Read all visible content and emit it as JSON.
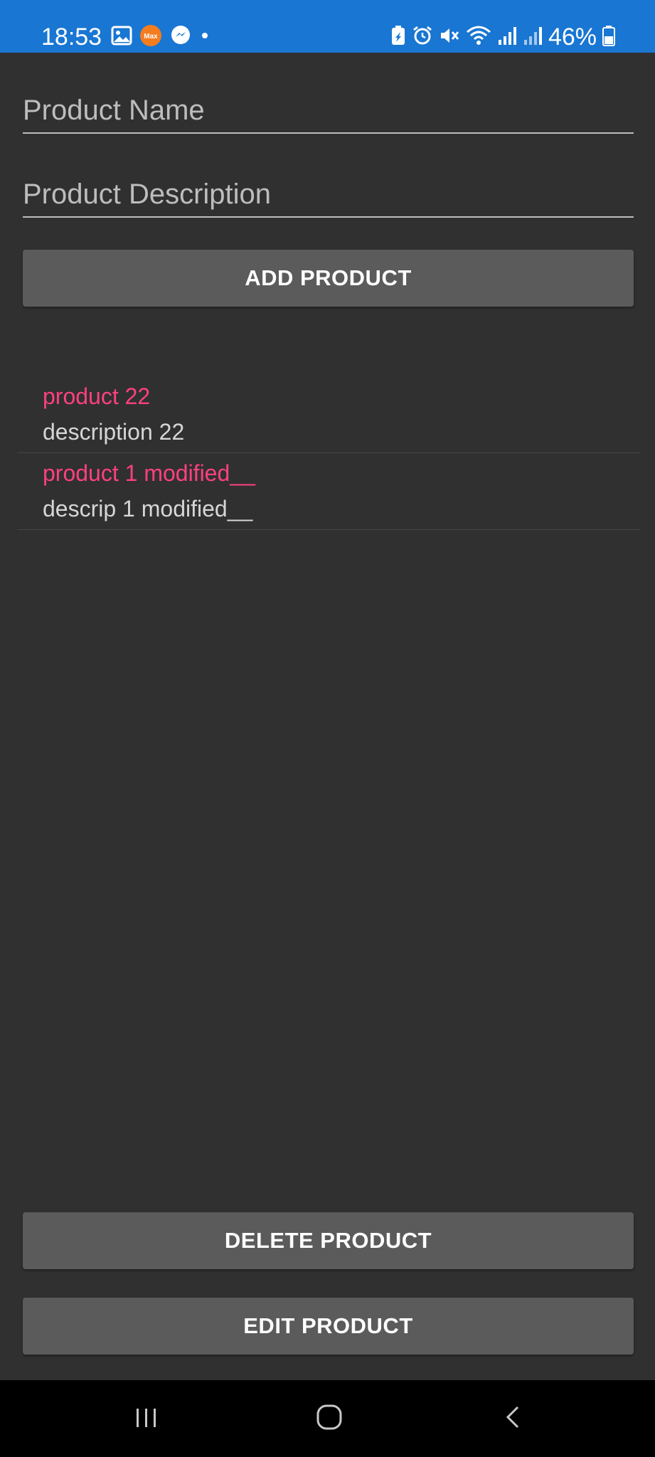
{
  "status_bar": {
    "time": "18:53",
    "battery": "46%",
    "left_icons": [
      "gallery-icon",
      "app-badge-icon",
      "messenger-icon",
      "notification-dot-icon"
    ],
    "right_icons": [
      "battery-saver-icon",
      "alarm-icon",
      "mute-icon",
      "wifi-icon",
      "signal-icon",
      "signal-icon",
      "battery-icon"
    ],
    "app_badge_text": "Max",
    "bg_color": "#1976d2"
  },
  "form": {
    "name_placeholder": "Product Name",
    "name_value": "",
    "description_placeholder": "Product Description",
    "description_value": "",
    "add_button": "ADD PRODUCT"
  },
  "products": [
    {
      "name": "product 22",
      "description": "description 22"
    },
    {
      "name": "product 1 modified__",
      "description": "descrip 1 modified__"
    }
  ],
  "actions": {
    "delete_button": "DELETE PRODUCT",
    "edit_button": "EDIT PRODUCT"
  },
  "nav_bar": {
    "recents_icon": "recents-icon",
    "home_icon": "home-icon",
    "back_icon": "back-icon"
  },
  "colors": {
    "accent": "#ff4081",
    "background": "#303030",
    "button": "#5b5b5b"
  }
}
